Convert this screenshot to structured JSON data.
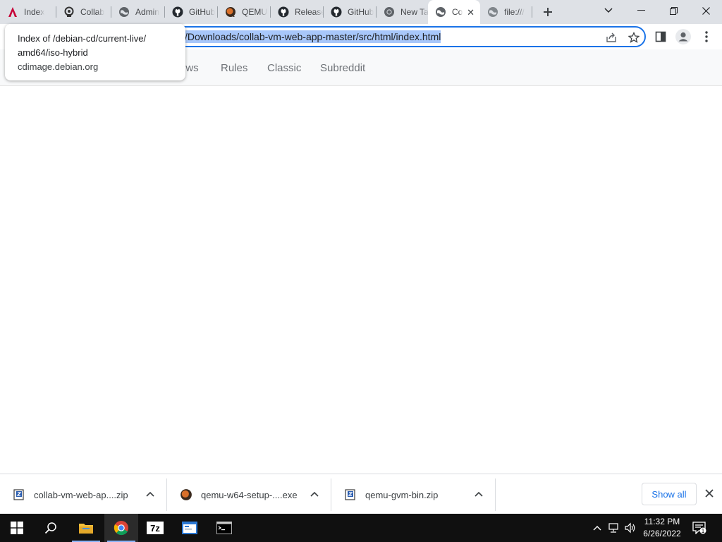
{
  "browser": {
    "tabs": [
      {
        "label": "Index",
        "icon": "debian-icon"
      },
      {
        "label": "Collab",
        "icon": "collab-icon"
      },
      {
        "label": "Admin",
        "icon": "globe-icon"
      },
      {
        "label": "GitHub",
        "icon": "github-icon"
      },
      {
        "label": "QEMU",
        "icon": "qemu-icon"
      },
      {
        "label": "Releases",
        "icon": "github-icon"
      },
      {
        "label": "GitHub",
        "icon": "github-icon"
      },
      {
        "label": "New Tab",
        "icon": "chrome-icon"
      },
      {
        "label": "Co",
        "icon": "globe-icon",
        "active": true
      },
      {
        "label": "file:///",
        "icon": "globe-icon"
      }
    ],
    "address_url": "/Downloads/collab-vm-web-app-master/src/html/index.html"
  },
  "tooltip": {
    "title_line1": "Index of /debian-cd/current-live/",
    "title_line2": "amd64/iso-hybrid",
    "host": "cdimage.debian.org"
  },
  "page": {
    "nav_links": [
      "ews",
      "Rules",
      "Classic",
      "Subreddit"
    ]
  },
  "downloads": {
    "items": [
      {
        "name": "collab-vm-web-ap....zip",
        "icon": "zip-file-icon"
      },
      {
        "name": "qemu-w64-setup-....exe",
        "icon": "qemu-icon"
      },
      {
        "name": "qemu-gvm-bin.zip",
        "icon": "zip-file-icon"
      }
    ],
    "show_all_label": "Show all"
  },
  "taskbar": {
    "time": "11:32 PM",
    "date": "6/26/2022",
    "notification_count": "1",
    "accent_color": "#8ab4f8"
  }
}
